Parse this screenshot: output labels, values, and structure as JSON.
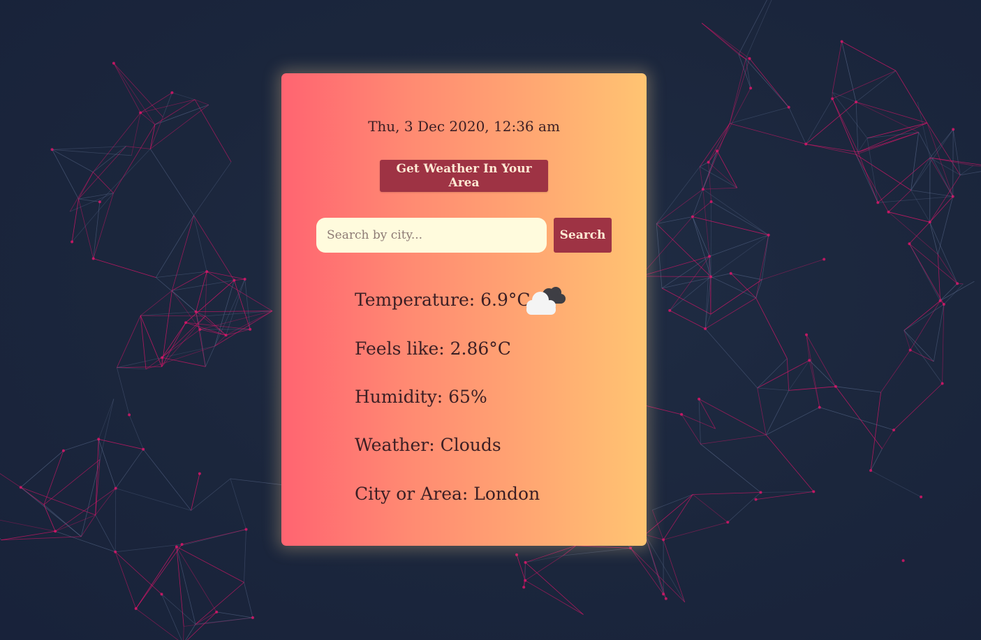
{
  "app": {
    "datetime": "Thu, 3 Dec 2020, 12:36 am",
    "geo_button_label": "Get Weather In Your Area",
    "search": {
      "placeholder": "Search by city...",
      "value": "",
      "button_label": "Search"
    },
    "weather": {
      "temperature": "Temperature: 6.9°C",
      "feels_like": "Feels like: 2.86°C",
      "humidity": "Humidity: 65%",
      "condition": "Weather: Clouds",
      "city": "City or Area: London",
      "icon": "broken-clouds-icon"
    }
  },
  "colors": {
    "background": "#1b263c",
    "card_gradient_start": "#ff6471",
    "card_gradient_end": "#ffc472",
    "button": "#9e3344",
    "button_text": "#ffe9d4",
    "input_background": "#fffbdd",
    "text": "#3b1f24",
    "network_pink": "#e0156a",
    "network_blue": "#5a6a8c"
  }
}
